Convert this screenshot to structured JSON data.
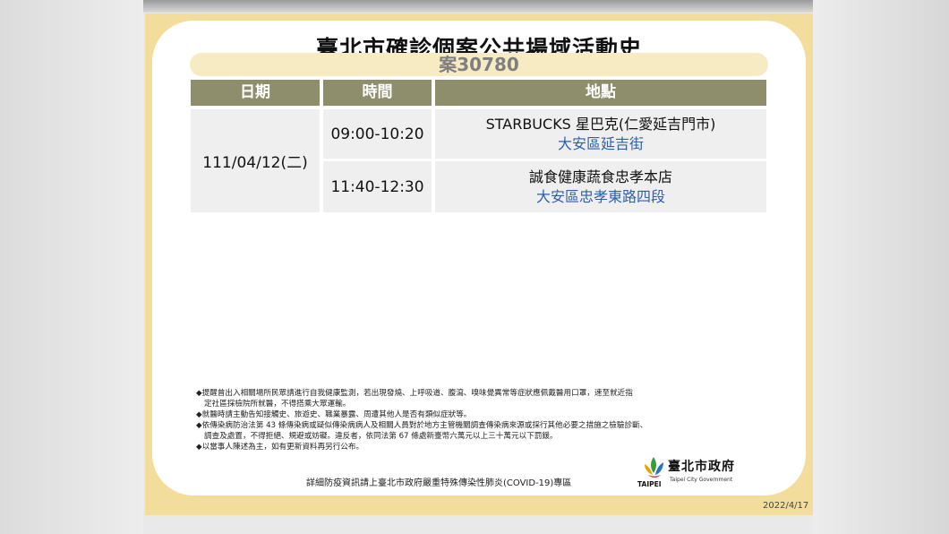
{
  "title": "臺北市確診個案公共場域活動史",
  "case_number": "案30780",
  "table": {
    "headers": [
      "日期",
      "時間",
      "地點"
    ],
    "date": "111/04/12(二)",
    "rows": [
      {
        "time": "09:00-10:20",
        "place": "STARBUCKS 星巴克(仁愛延吉門市)",
        "area": "大安區延吉街"
      },
      {
        "time": "11:40-12:30",
        "place": "誠食健康蔬食忠孝本店",
        "area": "大安區忠孝東路四段"
      }
    ]
  },
  "notes": [
    "◆提醒曾出入相關場所民眾請進行自我健康監測，若出現發燒、上呼吸道、腹瀉、嗅味覺異常等症狀應佩戴醫用口罩，速至就近指",
    "定社區採檢院所就醫，不得搭乘大眾運輸。",
    "◆就醫時請主動告知接觸史、旅遊史、職業暴露、周遭其他人是否有類似症狀等。",
    "◆依傳染病防治法第 43 條傳染病或疑似傳染病病人及相關人員對於地方主管機關調查傳染病來源或採行其他必要之措施之檢驗診斷、",
    "調查及處置，不得拒絕、規避或妨礙。違反者，依同法第 67 條處新臺幣六萬元以上三十萬元以下罰鍰。",
    "◆以當事人陳述為主，如有更新資料再另行公布。"
  ],
  "footer_link": "詳細防疫資訊請上臺北市政府嚴重特殊傳染性肺炎(COVID-19)專區",
  "logo": {
    "name": "臺北市政府",
    "sub": "Taipei City Government",
    "taipei": "TAIPEI"
  },
  "date_stamp": "2022/4/17",
  "colors": {
    "frame": "#f2dd9c",
    "header": "#8f8e6c",
    "area_text": "#2f5fa6",
    "cell": "#efefef"
  }
}
